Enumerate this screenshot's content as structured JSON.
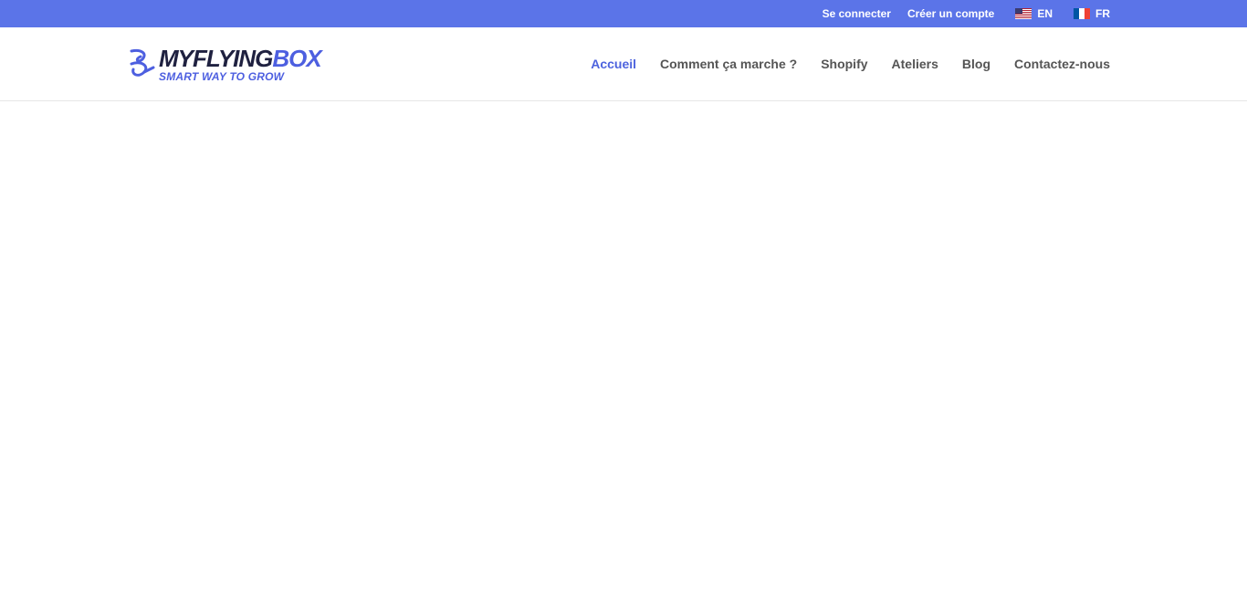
{
  "topbar": {
    "login": "Se connecter",
    "signup": "Créer un compte",
    "languages": [
      {
        "code": "EN",
        "flag": "us-flag-icon"
      },
      {
        "code": "FR",
        "flag": "fr-flag-icon"
      }
    ]
  },
  "logo": {
    "main_prefix": "MYFLYING",
    "main_accent": "BOX",
    "tagline": "SMART WAY TO GROW"
  },
  "nav": {
    "items": [
      {
        "label": "Accueil",
        "active": true
      },
      {
        "label": "Comment ça marche ?",
        "active": false
      },
      {
        "label": "Shopify",
        "active": false
      },
      {
        "label": "Ateliers",
        "active": false
      },
      {
        "label": "Blog",
        "active": false
      },
      {
        "label": "Contactez-nous",
        "active": false
      }
    ]
  },
  "colors": {
    "topbar_bg": "#5b74e8",
    "accent": "#4d63de",
    "nav_text": "#555555",
    "logo_dark": "#1f2140"
  }
}
